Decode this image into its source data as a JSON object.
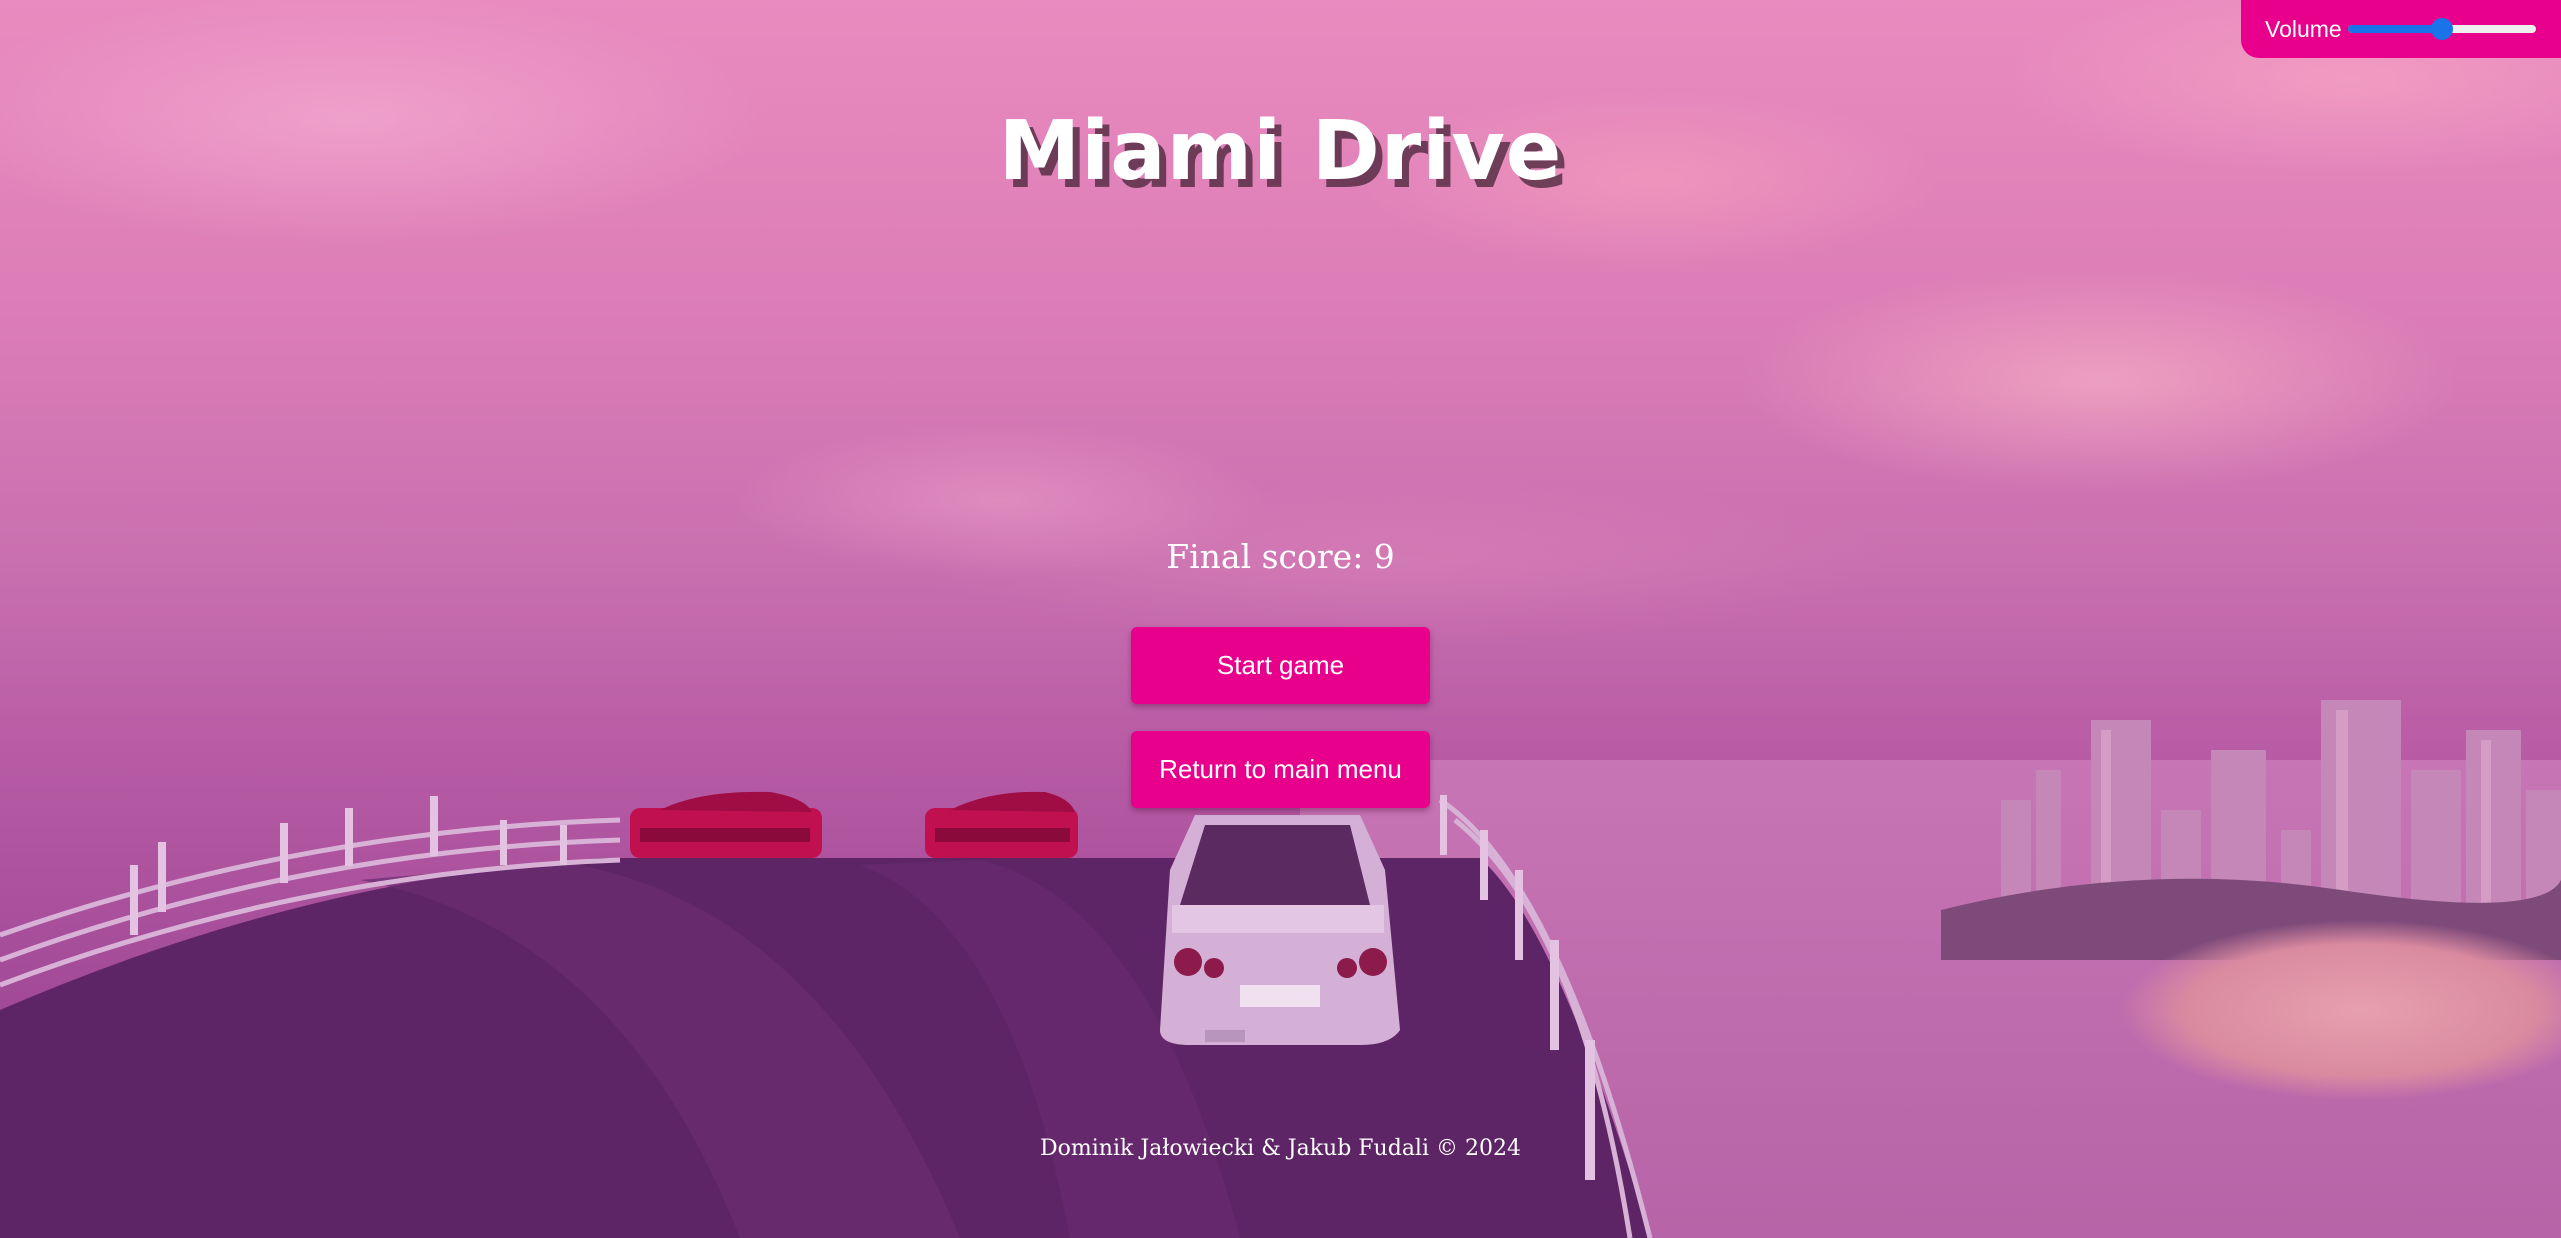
{
  "game": {
    "title": "Miami Drive",
    "final_score_label": "Final score:",
    "final_score_value": 9,
    "final_score_text": "Final score: 9"
  },
  "menu": {
    "start_label": "Start game",
    "return_label": "Return to main menu"
  },
  "footer": {
    "credits": "Dominik Jałowiecki & Jakub Fudali © 2024"
  },
  "volume": {
    "label": "Volume",
    "level": 0.5
  },
  "colors": {
    "accent": "#e8008c",
    "slider": "#1a73e8",
    "text": "#ffffff",
    "sky_top": "#e98bbf",
    "road": "#5e2566"
  }
}
